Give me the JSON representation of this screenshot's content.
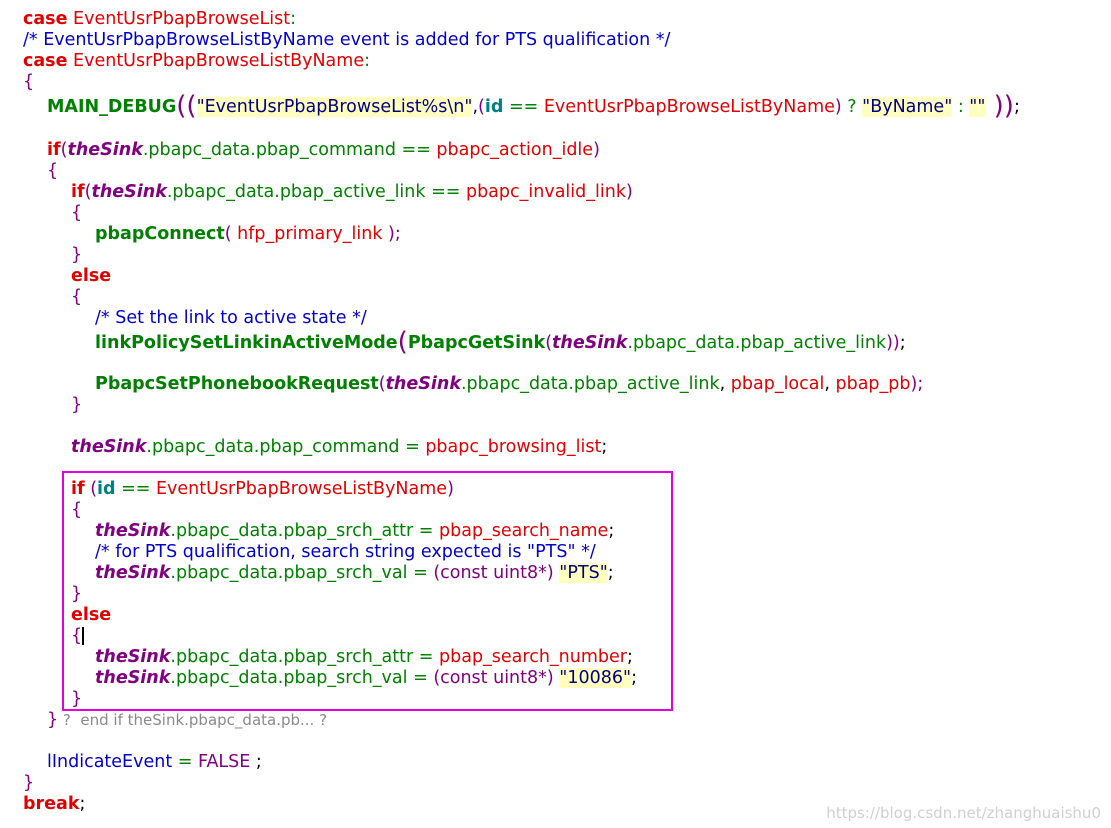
{
  "code": {
    "l1": {
      "kw": "case",
      "name": "EventUsrPbapBrowseList",
      "colon": ":"
    },
    "l2": {
      "comment": "/* EventUsrPbapBrowseListByName event is added for PTS qualification */"
    },
    "l3": {
      "kw": "case",
      "name": "EventUsrPbapBrowseListByName",
      "colon": ":"
    },
    "l4": {
      "brace": "{"
    },
    "l5": {
      "fn": "MAIN_DEBUG",
      "open": "((",
      "str1": "\"EventUsrPbapBrowseList%s\\n\"",
      "comma": ",",
      "paren": "(",
      "id": "id",
      "eq": " == ",
      "name": "EventUsrPbapBrowseListByName",
      "close": ")",
      "q": " ? ",
      "str2": "\"ByName\"",
      "col": " : ",
      "str3": "\"\"",
      "end1": " ))",
      "semi": ";"
    },
    "l6": {
      "kw": "if",
      "open": "(",
      "sink": "theSink",
      "member": ".pbapc_data.pbap_command",
      "eq": " == ",
      "val": "pbapc_action_idle",
      "close": ")"
    },
    "l7": {
      "brace": "{"
    },
    "l8": {
      "kw": "if",
      "open": "(",
      "sink": "theSink",
      "member": ".pbapc_data.pbap_active_link",
      "eq": " == ",
      "val": "pbapc_invalid_link",
      "close": ")"
    },
    "l9": {
      "brace": "{"
    },
    "l10": {
      "fn": "pbapConnect",
      "open": "( ",
      "arg": "hfp_primary_link",
      "close": " );"
    },
    "l11": {
      "brace": "}"
    },
    "l12": {
      "kw": "else"
    },
    "l13": {
      "brace": "{"
    },
    "l14": {
      "comment": "/* Set the link to active state */"
    },
    "l15": {
      "fn": "linkPolicySetLinkinActiveMode",
      "open": "(",
      "fn2": "PbapcGetSink",
      "open2": "(",
      "sink": "theSink",
      "member": ".pbapc_data.pbap_active_link",
      "close": "))",
      "semi": ";"
    },
    "l16": {
      "fn": "PbapcSetPhonebookRequest",
      "open": "(",
      "sink": "theSink",
      "member": ".pbapc_data.pbap_active_link",
      "comma1": ", ",
      "arg2": "pbap_local",
      "comma2": ", ",
      "arg3": "pbap_pb",
      "close": ");"
    },
    "l17": {
      "brace": "}"
    },
    "l18": {
      "sink": "theSink",
      "member": ".pbapc_data.pbap_command",
      "eq": " = ",
      "val": "pbapc_browsing_list",
      "semi": ";"
    },
    "l19": {
      "kw": "if",
      "open": " (",
      "id": "id",
      "eq": " == ",
      "name": "EventUsrPbapBrowseListByName",
      "close": ")"
    },
    "l20": {
      "brace": "{"
    },
    "l21": {
      "sink": "theSink",
      "member": ".pbapc_data.pbap_srch_attr",
      "eq": " = ",
      "val": "pbap_search_name",
      "semi": ";"
    },
    "l22": {
      "comment": "/* for PTS qualification, search string expected is \"PTS\" */"
    },
    "l23": {
      "sink": "theSink",
      "member": ".pbapc_data.pbap_srch_val",
      "eq": " = ",
      "cast": "(const uint8*) ",
      "str": "\"PTS\"",
      "semi": ";"
    },
    "l24": {
      "brace": "}"
    },
    "l25": {
      "kw": "else"
    },
    "l26": {
      "brace": "{"
    },
    "l27": {
      "sink": "theSink",
      "member": ".pbapc_data.pbap_srch_attr",
      "eq": " = ",
      "val": "pbap_search_number",
      "semi": ";"
    },
    "l28": {
      "sink": "theSink",
      "member": ".pbapc_data.pbap_srch_val",
      "eq": " = ",
      "cast": "(const uint8*) ",
      "str": "\"10086\"",
      "semi": ";"
    },
    "l29": {
      "brace": "}"
    },
    "l30": {
      "brace": "}",
      "fold": " ?  end if theSink.pbapc_data.pb... ?"
    },
    "l31": {
      "var": "lIndicateEvent",
      "eq": " = ",
      "val": "FALSE",
      "semi": " ;"
    },
    "l32": {
      "brace": "}"
    },
    "l33": {
      "kw": "break",
      "semi": ";"
    }
  },
  "watermark": "https://blog.csdn.net/zhanghuaishu0",
  "colors": {
    "keyword": "#e00000",
    "function": "#008000",
    "sink": "#800080",
    "comment": "#0000cc",
    "string_bg": "#ffffc0",
    "highlight_box": "#e000e0"
  }
}
